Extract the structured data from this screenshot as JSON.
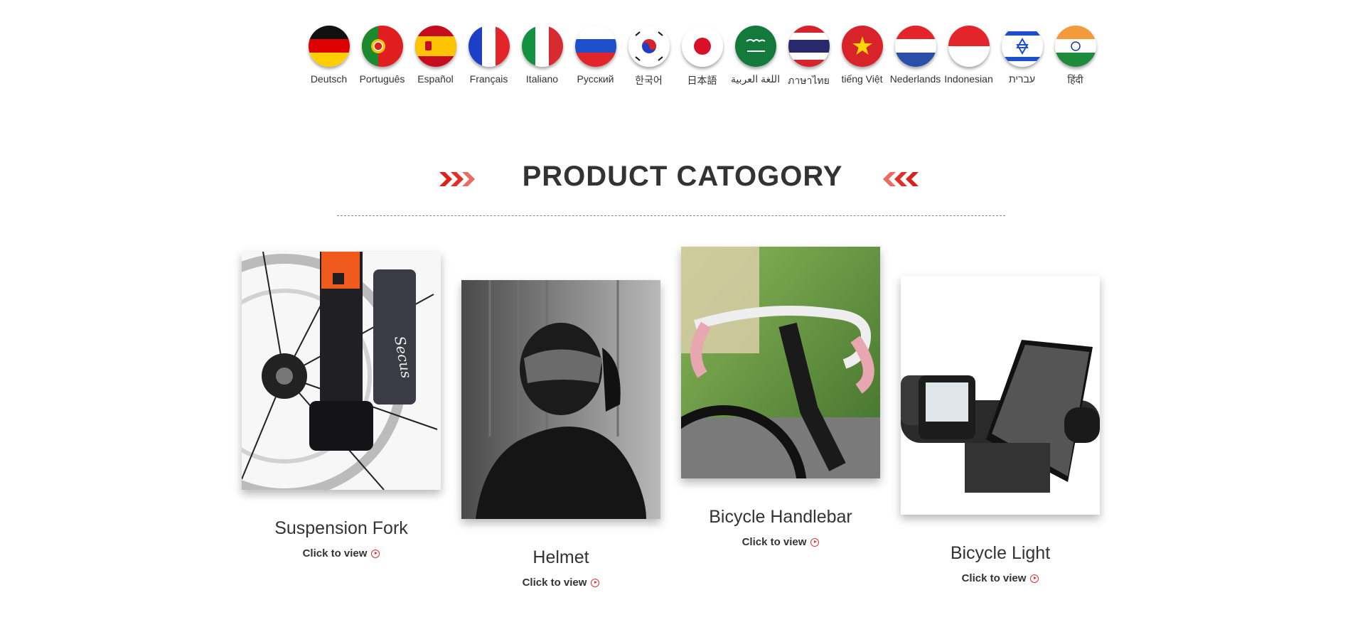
{
  "languages": [
    {
      "label": "Deutsch",
      "icon": "germany-flag-icon"
    },
    {
      "label": "Português",
      "icon": "portugal-flag-icon"
    },
    {
      "label": "Español",
      "icon": "spain-flag-icon"
    },
    {
      "label": "Français",
      "icon": "france-flag-icon"
    },
    {
      "label": "Italiano",
      "icon": "italy-flag-icon"
    },
    {
      "label": "Русский",
      "icon": "russia-flag-icon"
    },
    {
      "label": "한국어",
      "icon": "korea-flag-icon"
    },
    {
      "label": "日本語",
      "icon": "japan-flag-icon"
    },
    {
      "label": "اللغة العربية",
      "icon": "saudi-arabia-flag-icon"
    },
    {
      "label": "ภาษาไทย",
      "icon": "thailand-flag-icon"
    },
    {
      "label": "tiếng Việt",
      "icon": "vietnam-flag-icon"
    },
    {
      "label": "Nederlands",
      "icon": "netherlands-flag-icon"
    },
    {
      "label": "Indonesian",
      "icon": "indonesia-flag-icon"
    },
    {
      "label": "עברית",
      "icon": "israel-flag-icon"
    },
    {
      "label": "हिंदी",
      "icon": "india-flag-icon"
    }
  ],
  "section": {
    "title": "PRODUCT CATOGORY",
    "accent_color": "#e0201b"
  },
  "products": [
    {
      "name": "Suspension Fork",
      "link": "Click to view",
      "image": "suspension-fork-photo"
    },
    {
      "name": "Helmet",
      "link": "Click to view",
      "image": "helmet-photo"
    },
    {
      "name": "Bicycle Handlebar",
      "link": "Click to view",
      "image": "bicycle-handlebar-photo"
    },
    {
      "name": "Bicycle Light",
      "link": "Click to view",
      "image": "bicycle-light-photo"
    }
  ]
}
